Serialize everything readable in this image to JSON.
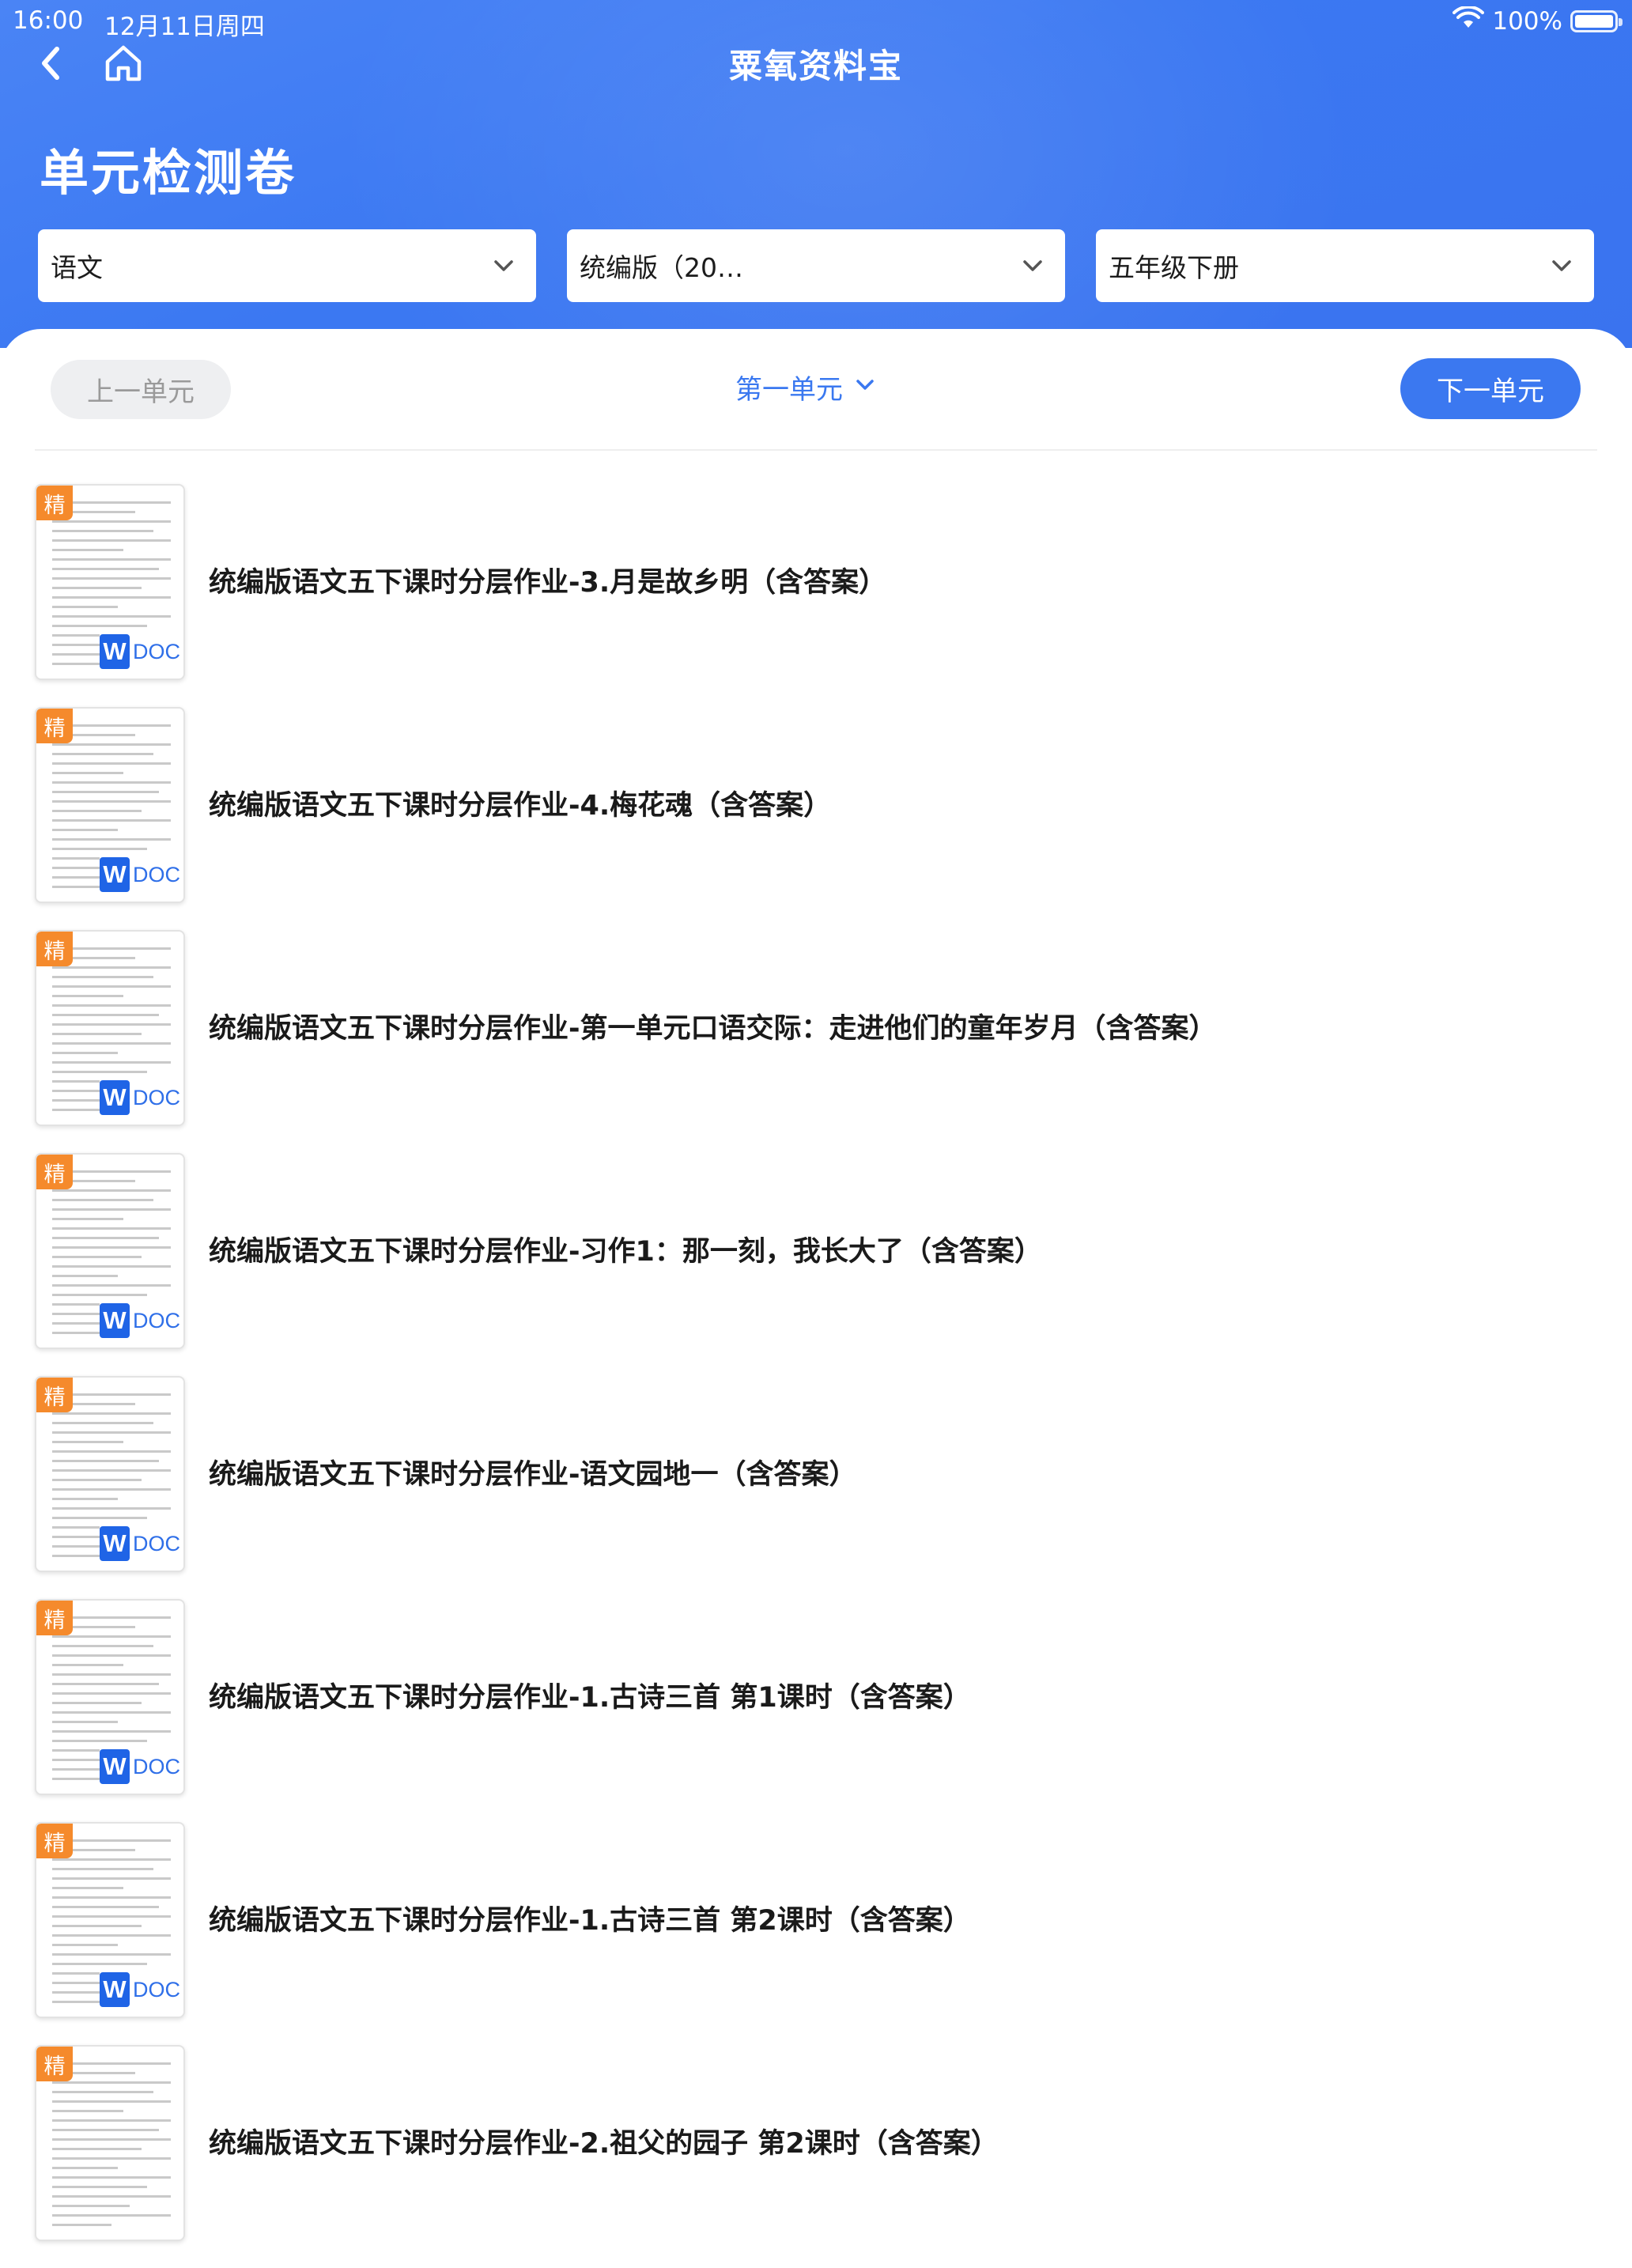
{
  "status_bar": {
    "time": "16:00",
    "date": "12月11日周四",
    "battery": "100%"
  },
  "header": {
    "app_title": "粟氧资料宝",
    "page_title": "单元检测卷"
  },
  "filters": {
    "subject": "语文",
    "edition": "统编版（20…",
    "grade": "五年级下册"
  },
  "unit_nav": {
    "prev_label": "上一单元",
    "current_unit": "第一单元",
    "next_label": "下一单元"
  },
  "badges": {
    "jing": "精",
    "w": "W",
    "doc": "DOC"
  },
  "icons": {
    "back": "back-arrow-icon",
    "home": "home-icon",
    "wifi": "wifi-icon",
    "battery": "battery-icon",
    "dropdown": "chevron-down-icon"
  },
  "colors": {
    "header_blue": "#3b78f2",
    "accent_blue": "#3b78f0",
    "jing_orange": "#f58a2c",
    "doc_blue": "#1f64e6"
  },
  "documents": [
    {
      "title": "统编版语文五下课时分层作业-3.月是故乡明（含答案）"
    },
    {
      "title": "统编版语文五下课时分层作业-4.梅花魂（含答案）"
    },
    {
      "title": "统编版语文五下课时分层作业-第一单元口语交际：走进他们的童年岁月（含答案）"
    },
    {
      "title": "统编版语文五下课时分层作业-习作1：那一刻，我长大了（含答案）"
    },
    {
      "title": "统编版语文五下课时分层作业-语文园地一（含答案）"
    },
    {
      "title": "统编版语文五下课时分层作业-1.古诗三首 第1课时（含答案）"
    },
    {
      "title": "统编版语文五下课时分层作业-1.古诗三首 第2课时（含答案）"
    },
    {
      "title": "统编版语文五下课时分层作业-2.祖父的园子 第2课时（含答案）"
    }
  ]
}
